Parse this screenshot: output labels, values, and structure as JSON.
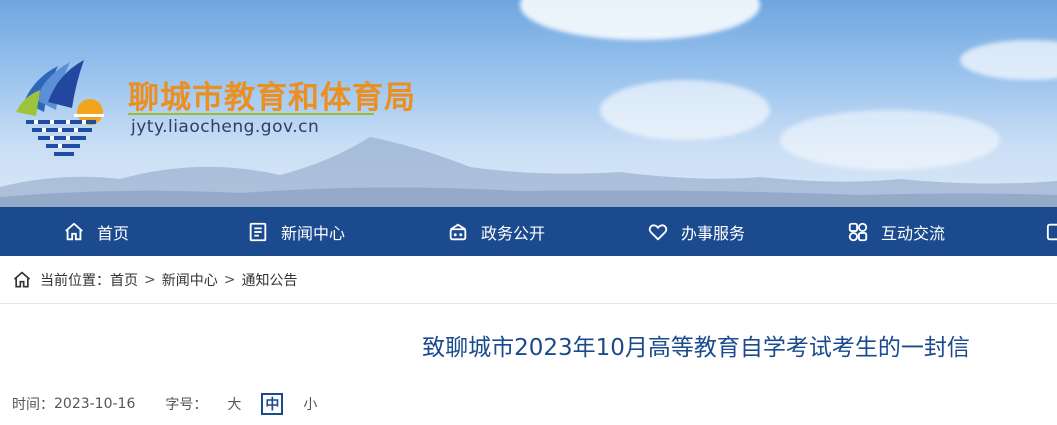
{
  "header": {
    "site_name": "聊城市教育和体育局",
    "site_domain": "jyty.liaocheng.gov.cn",
    "logo_icon": "liaocheng-education-logo"
  },
  "nav": {
    "items": [
      {
        "label": "首页",
        "icon": "home-icon"
      },
      {
        "label": "新闻中心",
        "icon": "news-icon"
      },
      {
        "label": "政务公开",
        "icon": "government-icon"
      },
      {
        "label": "办事服务",
        "icon": "heart-icon"
      },
      {
        "label": "互动交流",
        "icon": "interaction-icon"
      }
    ]
  },
  "breadcrumb": {
    "prefix": "当前位置：",
    "items": [
      "首页",
      "新闻中心",
      "通知公告"
    ],
    "separator": ">"
  },
  "article": {
    "title": "致聊城市2023年10月高等教育自学考试考生的一封信",
    "time_label": "时间：",
    "time_value": "2023-10-16",
    "font_size_label": "字号：",
    "font_sizes": [
      "大",
      "中",
      "小"
    ],
    "active_font_size": "中"
  },
  "colors": {
    "nav_bg": "#1b4a8e",
    "site_name": "#ea8f22",
    "title": "#1b4a8e"
  }
}
